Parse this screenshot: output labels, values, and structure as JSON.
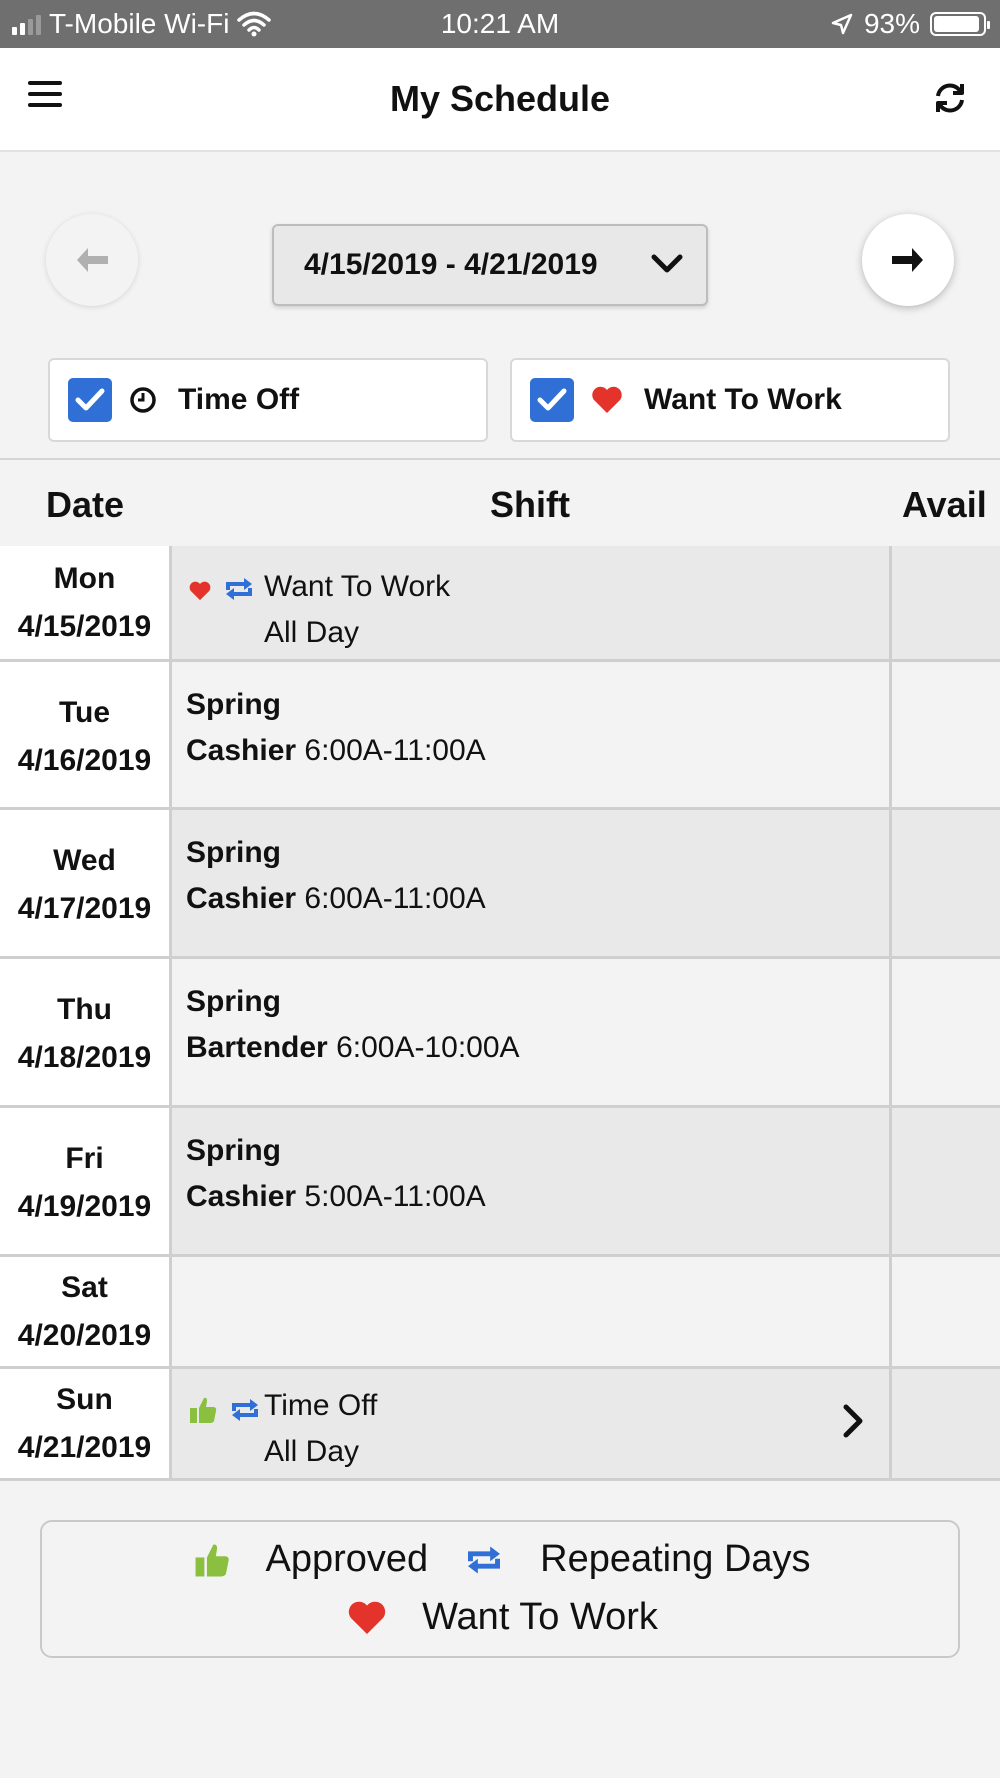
{
  "status_bar": {
    "carrier": "T-Mobile Wi-Fi",
    "time": "10:21 AM",
    "battery": "93%",
    "battery_level": 0.93
  },
  "header": {
    "title": "My Schedule",
    "menu_icon": "hamburger-menu-icon",
    "refresh_icon": "refresh-icon"
  },
  "nav": {
    "date_range": "4/15/2019 - 4/21/2019",
    "prev_icon": "arrow-left-icon",
    "next_icon": "arrow-right-icon"
  },
  "filters": [
    {
      "label": "Time Off",
      "checked": true,
      "icon": "clock-icon"
    },
    {
      "label": "Want To Work",
      "checked": true,
      "icon": "heart-icon"
    }
  ],
  "table": {
    "headers": {
      "date": "Date",
      "shift": "Shift",
      "avail": "Avail"
    },
    "rows": [
      {
        "dow": "Mon",
        "date": "4/15/2019",
        "type": "want",
        "title": "Want To Work",
        "sub": "All Day"
      },
      {
        "dow": "Tue",
        "date": "4/16/2019",
        "type": "shift",
        "location": "Spring",
        "role": "Cashier",
        "time": "6:00A-11:00A"
      },
      {
        "dow": "Wed",
        "date": "4/17/2019",
        "type": "shift",
        "location": "Spring",
        "role": "Cashier",
        "time": "6:00A-11:00A"
      },
      {
        "dow": "Thu",
        "date": "4/18/2019",
        "type": "shift",
        "location": "Spring",
        "role": "Bartender",
        "time": "6:00A-10:00A"
      },
      {
        "dow": "Fri",
        "date": "4/19/2019",
        "type": "shift",
        "location": "Spring",
        "role": "Cashier",
        "time": "5:00A-11:00A"
      },
      {
        "dow": "Sat",
        "date": "4/20/2019",
        "type": "empty"
      },
      {
        "dow": "Sun",
        "date": "4/21/2019",
        "type": "timeoff",
        "title": "Time Off",
        "sub": "All Day"
      }
    ]
  },
  "legend": {
    "approved": "Approved",
    "repeating": "Repeating Days",
    "want": "Want To Work"
  },
  "colors": {
    "heart": "#e3332a",
    "repeat": "#2f6fd6",
    "approved": "#8bbf3f",
    "checkbox": "#2f6fd6"
  }
}
